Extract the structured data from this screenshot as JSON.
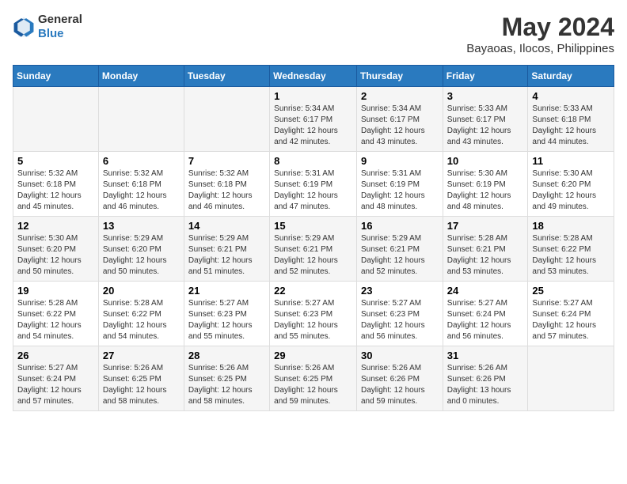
{
  "header": {
    "logo_general": "General",
    "logo_blue": "Blue",
    "title": "May 2024",
    "subtitle": "Bayaoas, Ilocos, Philippines"
  },
  "weekdays": [
    "Sunday",
    "Monday",
    "Tuesday",
    "Wednesday",
    "Thursday",
    "Friday",
    "Saturday"
  ],
  "weeks": [
    [
      {
        "day": "",
        "info": ""
      },
      {
        "day": "",
        "info": ""
      },
      {
        "day": "",
        "info": ""
      },
      {
        "day": "1",
        "info": "Sunrise: 5:34 AM\nSunset: 6:17 PM\nDaylight: 12 hours\nand 42 minutes."
      },
      {
        "day": "2",
        "info": "Sunrise: 5:34 AM\nSunset: 6:17 PM\nDaylight: 12 hours\nand 43 minutes."
      },
      {
        "day": "3",
        "info": "Sunrise: 5:33 AM\nSunset: 6:17 PM\nDaylight: 12 hours\nand 43 minutes."
      },
      {
        "day": "4",
        "info": "Sunrise: 5:33 AM\nSunset: 6:18 PM\nDaylight: 12 hours\nand 44 minutes."
      }
    ],
    [
      {
        "day": "5",
        "info": "Sunrise: 5:32 AM\nSunset: 6:18 PM\nDaylight: 12 hours\nand 45 minutes."
      },
      {
        "day": "6",
        "info": "Sunrise: 5:32 AM\nSunset: 6:18 PM\nDaylight: 12 hours\nand 46 minutes."
      },
      {
        "day": "7",
        "info": "Sunrise: 5:32 AM\nSunset: 6:18 PM\nDaylight: 12 hours\nand 46 minutes."
      },
      {
        "day": "8",
        "info": "Sunrise: 5:31 AM\nSunset: 6:19 PM\nDaylight: 12 hours\nand 47 minutes."
      },
      {
        "day": "9",
        "info": "Sunrise: 5:31 AM\nSunset: 6:19 PM\nDaylight: 12 hours\nand 48 minutes."
      },
      {
        "day": "10",
        "info": "Sunrise: 5:30 AM\nSunset: 6:19 PM\nDaylight: 12 hours\nand 48 minutes."
      },
      {
        "day": "11",
        "info": "Sunrise: 5:30 AM\nSunset: 6:20 PM\nDaylight: 12 hours\nand 49 minutes."
      }
    ],
    [
      {
        "day": "12",
        "info": "Sunrise: 5:30 AM\nSunset: 6:20 PM\nDaylight: 12 hours\nand 50 minutes."
      },
      {
        "day": "13",
        "info": "Sunrise: 5:29 AM\nSunset: 6:20 PM\nDaylight: 12 hours\nand 50 minutes."
      },
      {
        "day": "14",
        "info": "Sunrise: 5:29 AM\nSunset: 6:21 PM\nDaylight: 12 hours\nand 51 minutes."
      },
      {
        "day": "15",
        "info": "Sunrise: 5:29 AM\nSunset: 6:21 PM\nDaylight: 12 hours\nand 52 minutes."
      },
      {
        "day": "16",
        "info": "Sunrise: 5:29 AM\nSunset: 6:21 PM\nDaylight: 12 hours\nand 52 minutes."
      },
      {
        "day": "17",
        "info": "Sunrise: 5:28 AM\nSunset: 6:21 PM\nDaylight: 12 hours\nand 53 minutes."
      },
      {
        "day": "18",
        "info": "Sunrise: 5:28 AM\nSunset: 6:22 PM\nDaylight: 12 hours\nand 53 minutes."
      }
    ],
    [
      {
        "day": "19",
        "info": "Sunrise: 5:28 AM\nSunset: 6:22 PM\nDaylight: 12 hours\nand 54 minutes."
      },
      {
        "day": "20",
        "info": "Sunrise: 5:28 AM\nSunset: 6:22 PM\nDaylight: 12 hours\nand 54 minutes."
      },
      {
        "day": "21",
        "info": "Sunrise: 5:27 AM\nSunset: 6:23 PM\nDaylight: 12 hours\nand 55 minutes."
      },
      {
        "day": "22",
        "info": "Sunrise: 5:27 AM\nSunset: 6:23 PM\nDaylight: 12 hours\nand 55 minutes."
      },
      {
        "day": "23",
        "info": "Sunrise: 5:27 AM\nSunset: 6:23 PM\nDaylight: 12 hours\nand 56 minutes."
      },
      {
        "day": "24",
        "info": "Sunrise: 5:27 AM\nSunset: 6:24 PM\nDaylight: 12 hours\nand 56 minutes."
      },
      {
        "day": "25",
        "info": "Sunrise: 5:27 AM\nSunset: 6:24 PM\nDaylight: 12 hours\nand 57 minutes."
      }
    ],
    [
      {
        "day": "26",
        "info": "Sunrise: 5:27 AM\nSunset: 6:24 PM\nDaylight: 12 hours\nand 57 minutes."
      },
      {
        "day": "27",
        "info": "Sunrise: 5:26 AM\nSunset: 6:25 PM\nDaylight: 12 hours\nand 58 minutes."
      },
      {
        "day": "28",
        "info": "Sunrise: 5:26 AM\nSunset: 6:25 PM\nDaylight: 12 hours\nand 58 minutes."
      },
      {
        "day": "29",
        "info": "Sunrise: 5:26 AM\nSunset: 6:25 PM\nDaylight: 12 hours\nand 59 minutes."
      },
      {
        "day": "30",
        "info": "Sunrise: 5:26 AM\nSunset: 6:26 PM\nDaylight: 12 hours\nand 59 minutes."
      },
      {
        "day": "31",
        "info": "Sunrise: 5:26 AM\nSunset: 6:26 PM\nDaylight: 13 hours\nand 0 minutes."
      },
      {
        "day": "",
        "info": ""
      }
    ]
  ]
}
